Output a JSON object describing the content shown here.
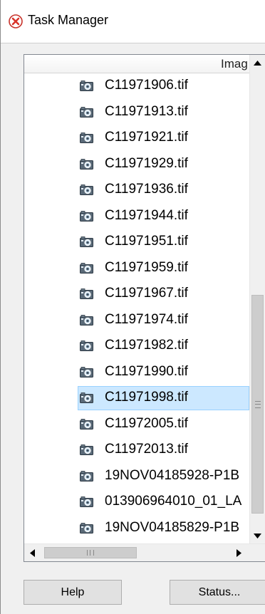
{
  "window": {
    "title": "Task Manager",
    "icon": "red-x-circle-icon"
  },
  "list": {
    "column_header": "Imag",
    "rows": [
      {
        "label": "C11971906.tif",
        "selected": false
      },
      {
        "label": "C11971913.tif",
        "selected": false
      },
      {
        "label": "C11971921.tif",
        "selected": false
      },
      {
        "label": "C11971929.tif",
        "selected": false
      },
      {
        "label": "C11971936.tif",
        "selected": false
      },
      {
        "label": "C11971944.tif",
        "selected": false
      },
      {
        "label": "C11971951.tif",
        "selected": false
      },
      {
        "label": "C11971959.tif",
        "selected": false
      },
      {
        "label": "C11971967.tif",
        "selected": false
      },
      {
        "label": "C11971974.tif",
        "selected": false
      },
      {
        "label": "C11971982.tif",
        "selected": false
      },
      {
        "label": "C11971990.tif",
        "selected": false
      },
      {
        "label": "C11971998.tif",
        "selected": true
      },
      {
        "label": "C11972005.tif",
        "selected": false
      },
      {
        "label": "C11972013.tif",
        "selected": false
      },
      {
        "label": "19NOV04185928-P1B",
        "selected": false
      },
      {
        "label": "013906964010_01_LA",
        "selected": false
      },
      {
        "label": "19NOV04185829-P1B",
        "selected": false
      }
    ],
    "row_icon": "camera-icon"
  },
  "buttons": {
    "help": "Help",
    "status": "Status..."
  },
  "colors": {
    "selection_bg": "#cce8ff",
    "selection_border": "#99d1ff",
    "client_bg": "#f0f0f0",
    "button_bg": "#e1e1e1",
    "title_icon_red": "#d9342b"
  }
}
